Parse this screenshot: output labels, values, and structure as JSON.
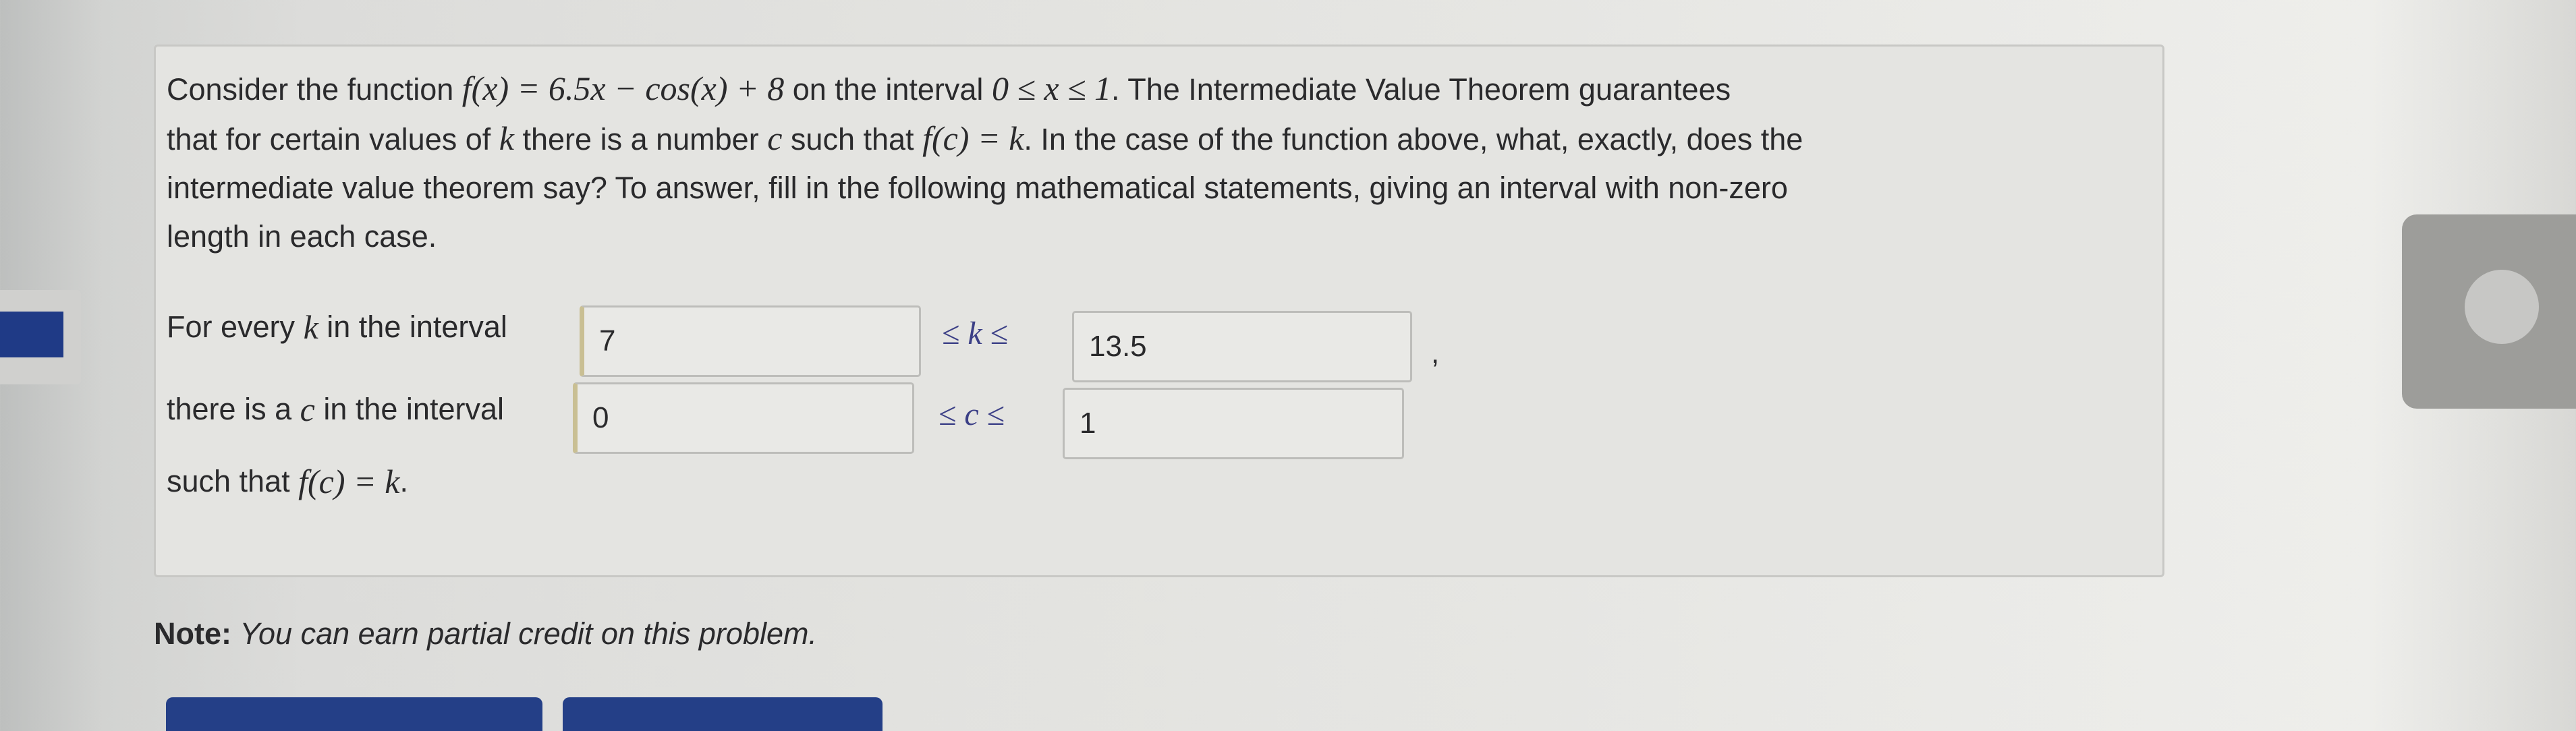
{
  "problem": {
    "intro": "Consider the function",
    "func_def": "f(x) = 6.5x − cos(x) + 8",
    "on_interval": "on the interval",
    "domain": "0 ≤ x ≤ 1",
    "theorem_text": ". The Intermediate Value Theorem guarantees",
    "line2_a": "that for certain values of",
    "k": "k",
    "line2_b": "there is a number",
    "c": "c",
    "line2_c": "such that",
    "fck": "f(c) = k",
    "line2_d": ". In the case of the function above, what, exactly, does the",
    "line3": "intermediate value theorem say? To answer, fill in the following mathematical statements, giving an interval with non-zero",
    "line4": "length in each case."
  },
  "rows": {
    "k_label_a": "For every",
    "k_label_b": "in the interval",
    "k_ineq": "≤ k ≤",
    "k_low": "7",
    "k_high": "13.5",
    "comma": ",",
    "c_label_a": "there is a",
    "c_label_b": "in the interval",
    "c_ineq": "≤ c ≤",
    "c_low": "0",
    "c_high": "1",
    "such_that": "such that",
    "final_eq": "f(c) = k",
    "period": "."
  },
  "note": {
    "label": "Note:",
    "text": "You can earn partial credit on this problem."
  }
}
